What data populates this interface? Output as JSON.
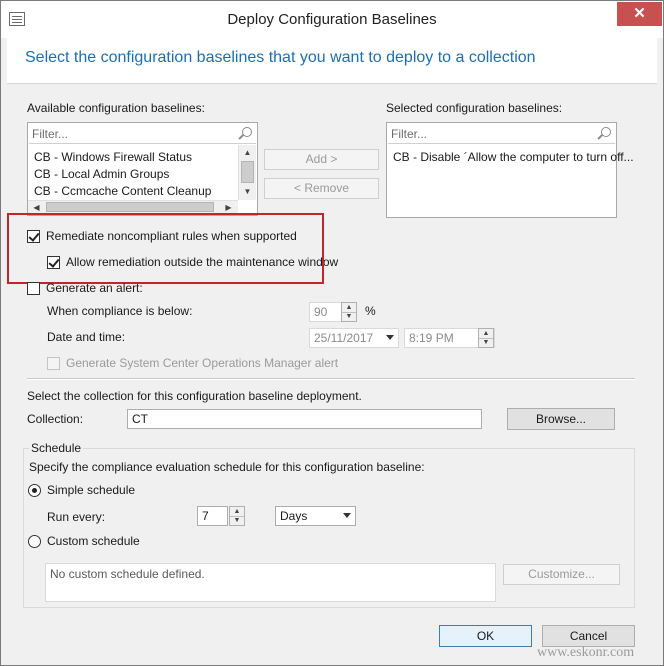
{
  "window": {
    "title": "Deploy Configuration Baselines",
    "close_label": "✕"
  },
  "header": {
    "text": "Select the configuration baselines that you want to deploy to a collection"
  },
  "available": {
    "label": "Available configuration baselines:",
    "filter_placeholder": "Filter...",
    "items": [
      "CB - Windows Firewall Status",
      "CB - Local Admin Groups",
      "CB - Ccmcache Content Cleanup"
    ]
  },
  "selected": {
    "label": "Selected configuration baselines:",
    "filter_placeholder": "Filter...",
    "items": [
      "CB - Disable ´Allow the computer to turn off..."
    ]
  },
  "buttons": {
    "add": "Add >",
    "remove": "< Remove",
    "browse": "Browse...",
    "customize": "Customize...",
    "ok": "OK",
    "cancel": "Cancel"
  },
  "remediate": {
    "label": "Remediate noncompliant rules when supported",
    "checked": true,
    "allow_outside_label": "Allow remediation outside the maintenance window",
    "allow_outside_checked": true
  },
  "alert": {
    "label": "Generate an alert:",
    "checked": false,
    "compliance_label": "When compliance is below:",
    "compliance_value": "90",
    "percent": "%",
    "datetime_label": "Date and time:",
    "date": "25/11/2017",
    "time": "8:19 PM",
    "scom_label": "Generate System Center Operations Manager alert",
    "scom_checked": false
  },
  "collection": {
    "instruction": "Select the collection for this configuration baseline deployment.",
    "label": "Collection:",
    "value": "CT"
  },
  "schedule": {
    "title": "Schedule",
    "instruction": "Specify the compliance evaluation schedule for this configuration baseline:",
    "simple_label": "Simple schedule",
    "simple_selected": true,
    "run_every_label": "Run every:",
    "run_every_value": "7",
    "unit": "Days",
    "custom_label": "Custom schedule",
    "custom_selected": false,
    "custom_text": "No custom schedule defined."
  },
  "watermark": "www.eskonr.com",
  "colors": {
    "header_text": "#1a6fb5",
    "close_button": "#c75050",
    "highlight_border": "#c0272d"
  }
}
